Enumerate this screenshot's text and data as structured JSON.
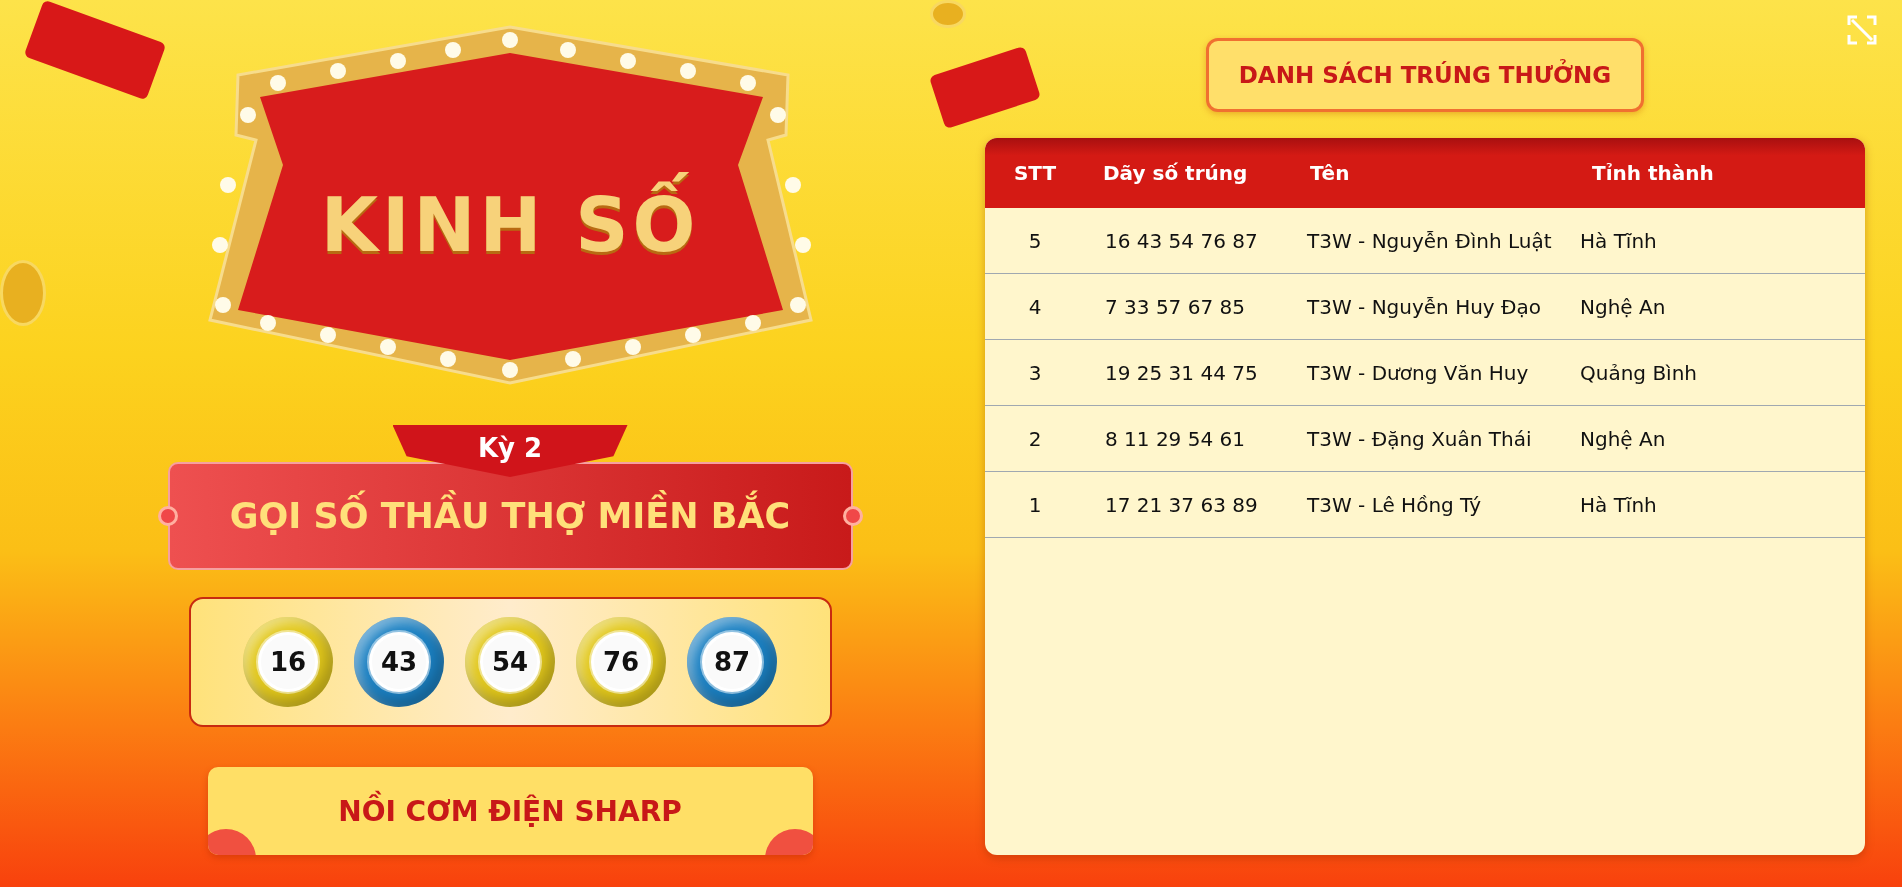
{
  "logo": {
    "text": "KINH SỐ"
  },
  "round": {
    "label": "Kỳ 2"
  },
  "title": "GỌI SỐ THẦU THỢ MIỀN BẮC",
  "balls": [
    {
      "number": "16",
      "color": "#e2c81c"
    },
    {
      "number": "43",
      "color": "#1b80c2"
    },
    {
      "number": "54",
      "color": "#e2c81c"
    },
    {
      "number": "76",
      "color": "#e2c81c"
    },
    {
      "number": "87",
      "color": "#1b80c2"
    }
  ],
  "prize": "NỒI CƠM ĐIỆN SHARP",
  "winners_button": "DANH SÁCH TRÚNG THƯỞNG",
  "table": {
    "columns": [
      "STT",
      "Dãy số trúng",
      "Tên",
      "Tỉnh thành"
    ],
    "rows": [
      [
        "5",
        "16 43 54 76 87",
        "T3W - Nguyễn Đình Luật",
        "Hà Tĩnh"
      ],
      [
        "4",
        "7 33 57 67 85",
        "T3W - Nguyễn Huy Đạo",
        "Nghệ An"
      ],
      [
        "3",
        "19 25 31 44 75",
        "T3W - Dương Văn Huy",
        "Quảng Bình"
      ],
      [
        "2",
        "8 11 29 54 61",
        "T3W - Đặng Xuân Thái",
        "Nghệ An"
      ],
      [
        "1",
        "17 21 37 63 89",
        "T3W - Lê Hồng Tý",
        "Hà Tĩnh"
      ]
    ]
  }
}
